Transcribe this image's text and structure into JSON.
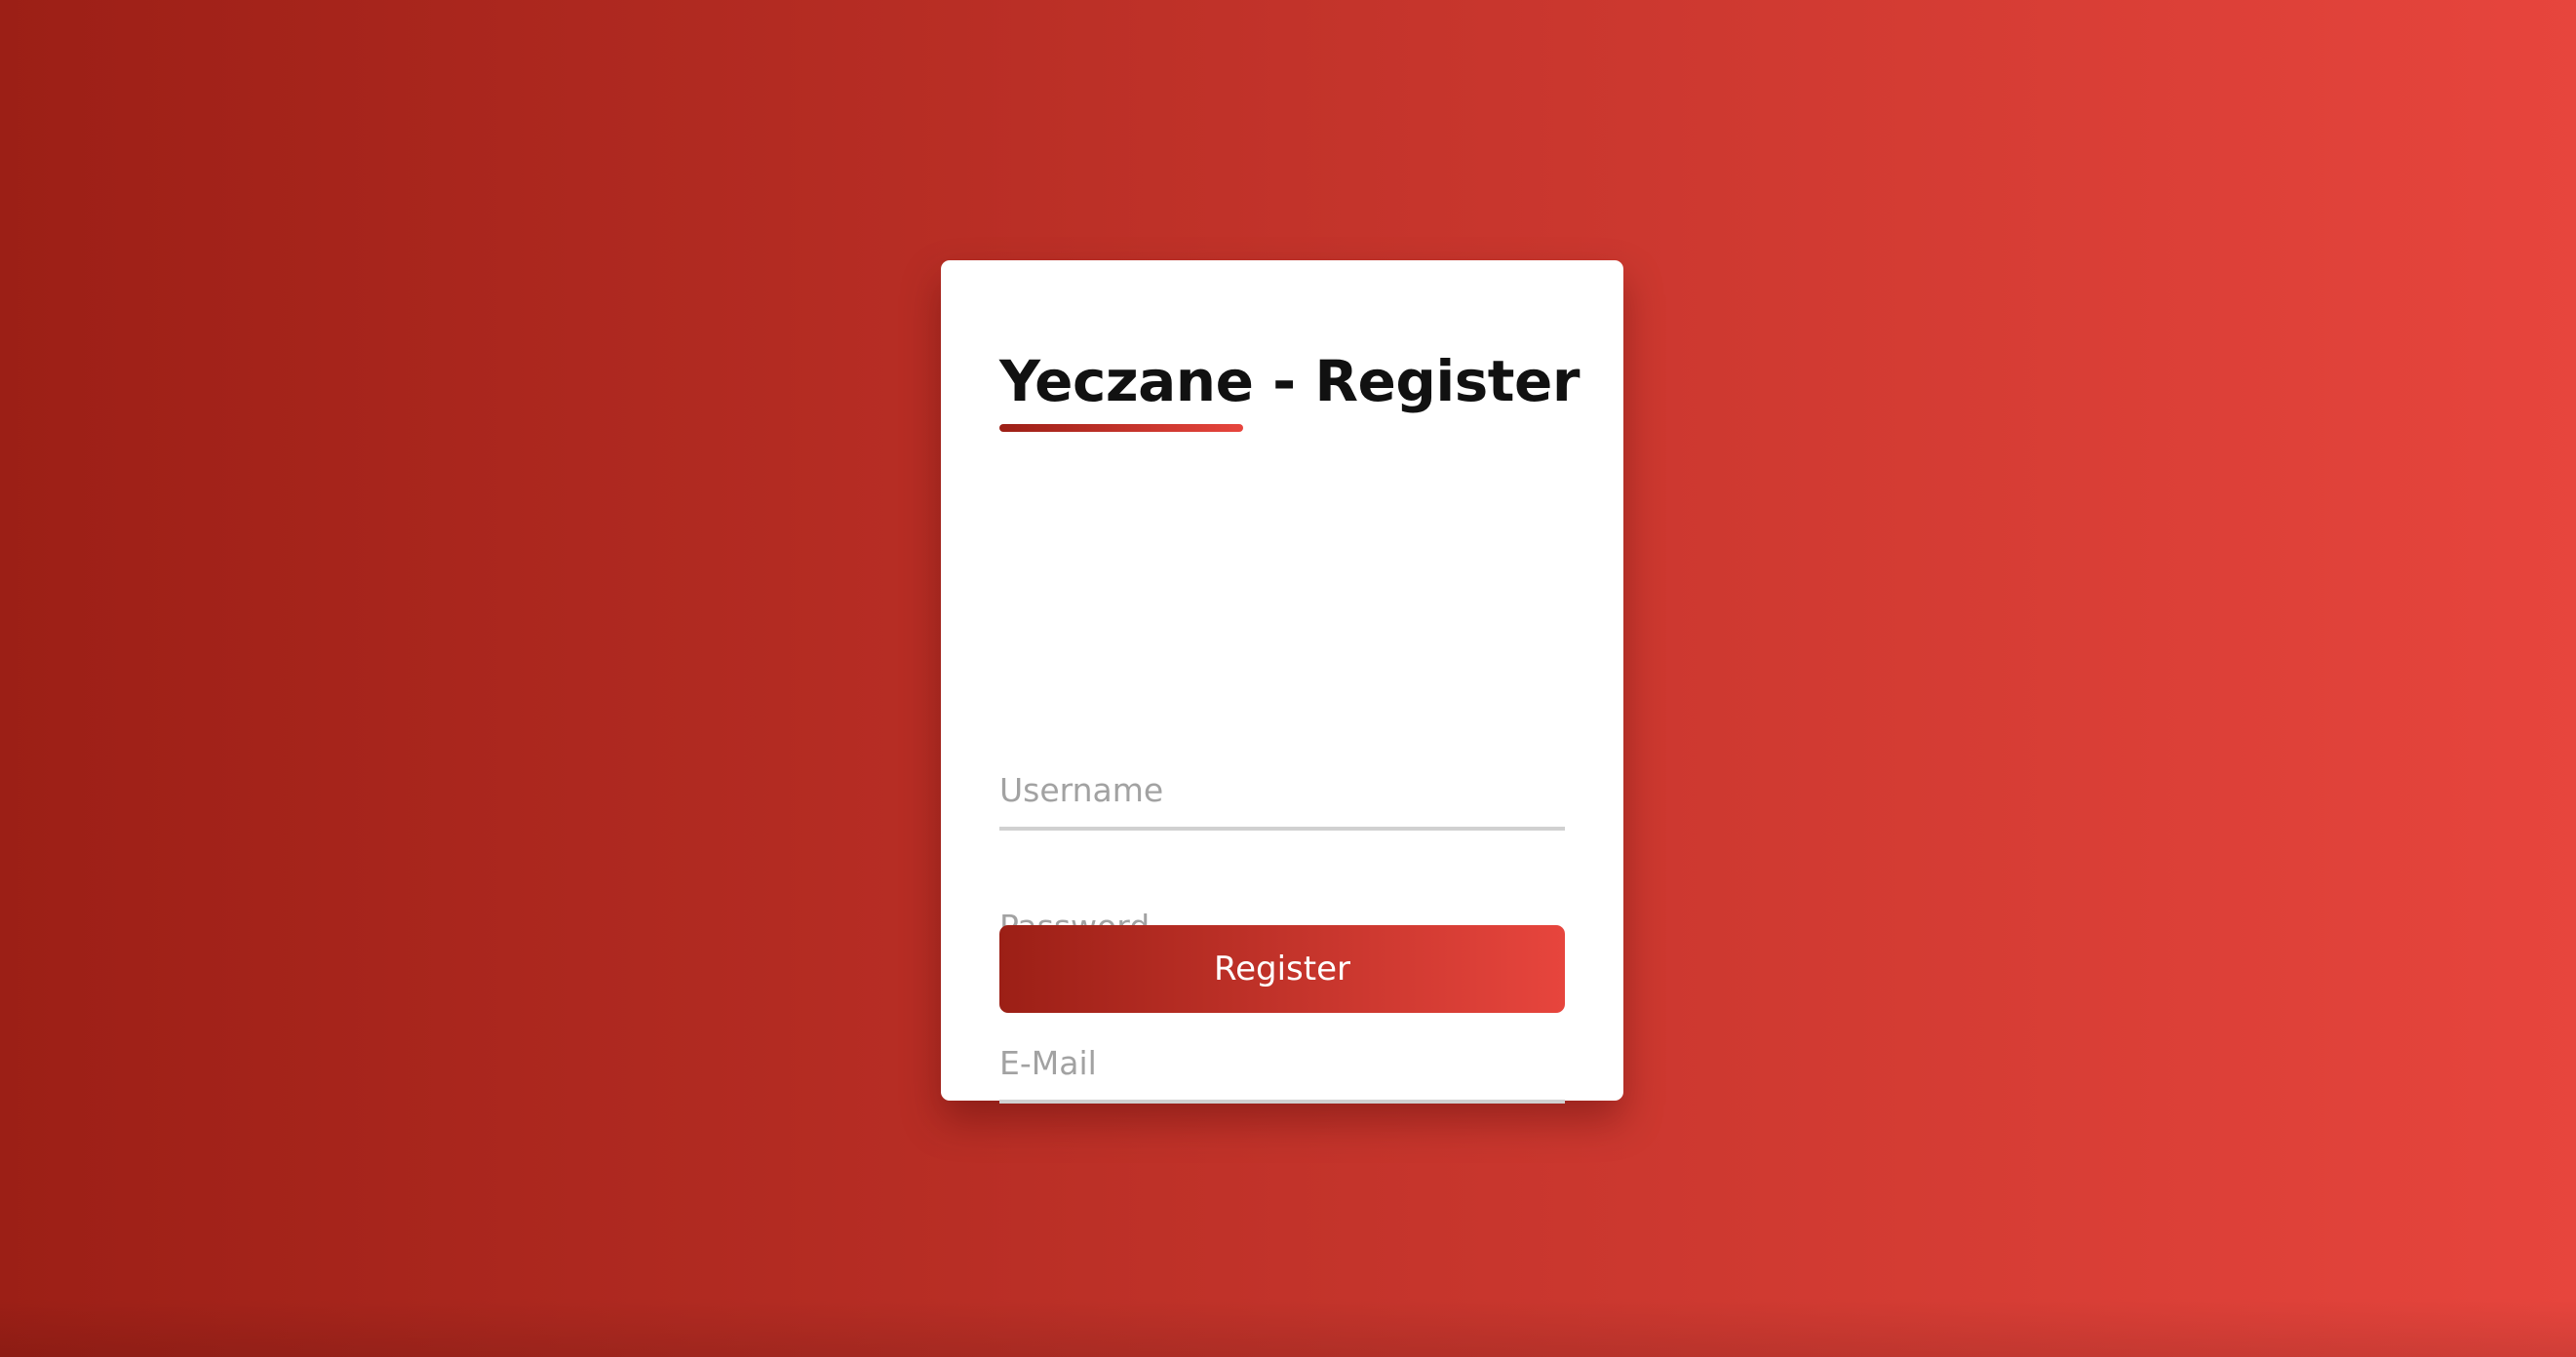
{
  "form": {
    "title_brand": "Yeczane",
    "title_rest": " - Register",
    "username": {
      "placeholder": "Username",
      "value": ""
    },
    "password": {
      "placeholder": "Password",
      "value": ""
    },
    "email": {
      "placeholder": "E-Mail",
      "value": ""
    },
    "submit_label": "Register"
  },
  "colors": {
    "gradient_start": "#9c1f16",
    "gradient_end": "#e7453d",
    "card_background": "#ffffff",
    "title_text": "#111111",
    "placeholder_text": "#a2a2a2",
    "field_underline": "#d0d0d0"
  }
}
